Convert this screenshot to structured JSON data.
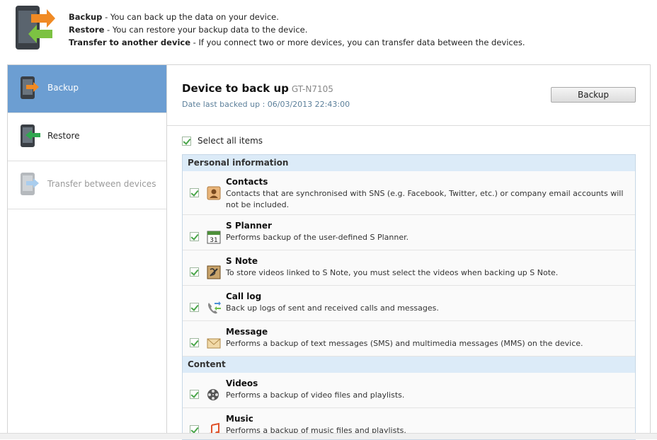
{
  "header": {
    "lines": [
      {
        "label": "Backup",
        "text": " - You can back up the data on your device."
      },
      {
        "label": "Restore",
        "text": " - You can restore your backup data to the device."
      },
      {
        "label": "Transfer to another device",
        "text": " - If you connect two or more devices, you can transfer data between the devices."
      }
    ]
  },
  "sidebar": {
    "items": [
      {
        "label": "Backup",
        "icon": "phone-export-icon"
      },
      {
        "label": "Restore",
        "icon": "phone-import-icon"
      },
      {
        "label": "Transfer between devices",
        "icon": "transfer-devices-icon"
      }
    ]
  },
  "main": {
    "title": "Device to back up",
    "model": "GT-N7105",
    "date": "Date last backed up : 06/03/2013 22:43:00",
    "backup_button": "Backup",
    "select_all": "Select all items",
    "sections": [
      {
        "name": "Personal information",
        "items": [
          {
            "title": "Contacts",
            "desc": "Contacts that are synchronised with SNS (e.g. Facebook, Twitter, etc.) or company email accounts will not be included.",
            "icon": "contacts-icon"
          },
          {
            "title": "S Planner",
            "desc": "Performs backup of the user-defined S Planner.",
            "icon": "calendar-icon",
            "cal_day": "31"
          },
          {
            "title": "S Note",
            "desc": "To store videos linked to S Note, you must select the videos when backing up S Note.",
            "icon": "s-note-icon"
          },
          {
            "title": "Call log",
            "desc": "Back up logs of sent and received calls and messages.",
            "icon": "call-log-icon"
          },
          {
            "title": "Message",
            "desc": "Performs a backup of text messages (SMS) and multimedia messages (MMS) on the device.",
            "icon": "envelope-icon"
          }
        ]
      },
      {
        "name": "Content",
        "items": [
          {
            "title": "Videos",
            "desc": "Performs a backup of video files and playlists.",
            "icon": "film-reel-icon"
          },
          {
            "title": "Music",
            "desc": "Performs a backup of music files and playlists.",
            "icon": "music-note-icon"
          }
        ]
      }
    ]
  },
  "colors": {
    "active_nav": "#6c9ed2",
    "section_head": "#dcebf8",
    "check": "#4aa64a",
    "date_text": "#5b7f9a"
  }
}
